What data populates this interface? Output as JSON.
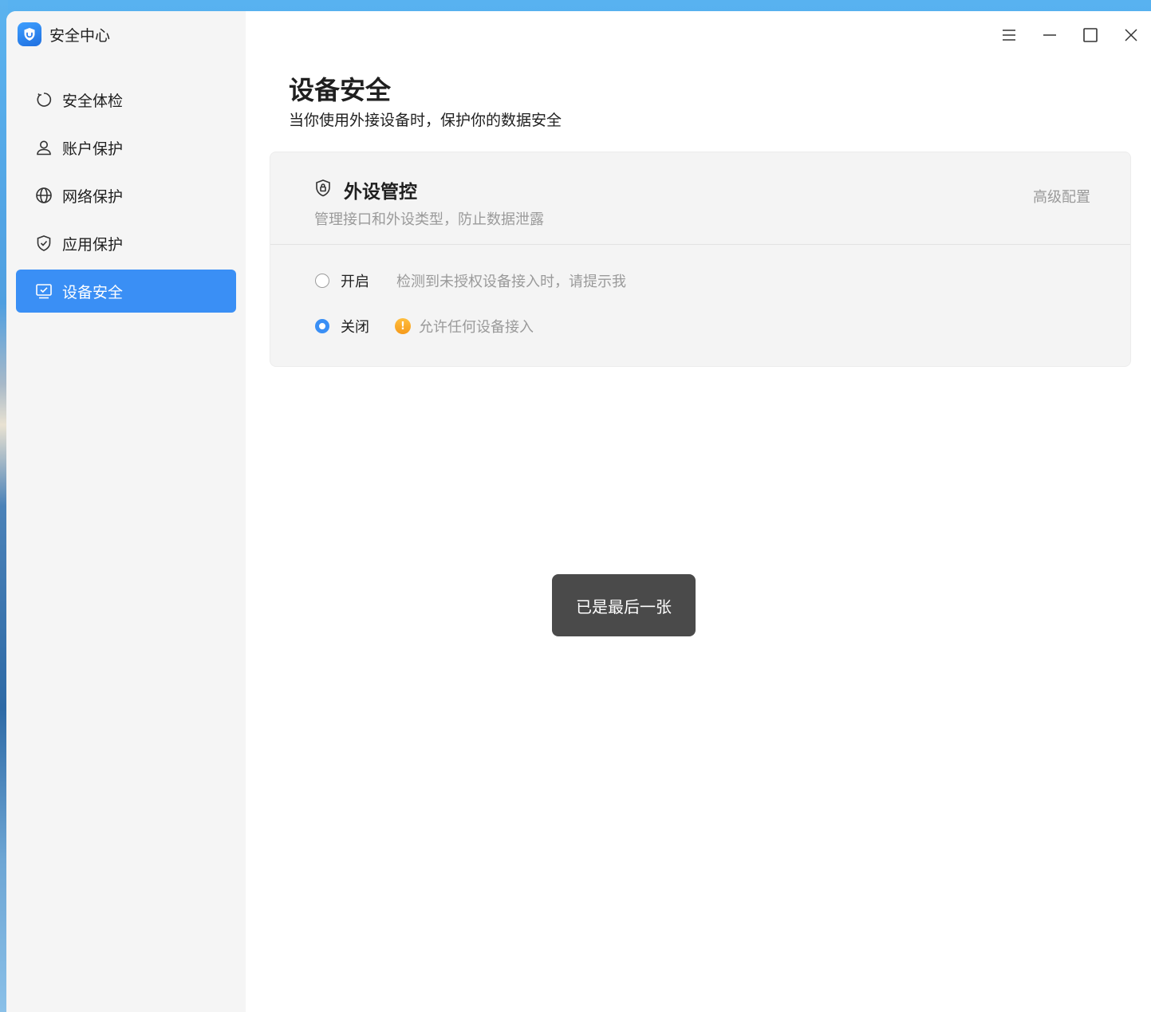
{
  "app": {
    "title": "安全中心"
  },
  "sidebar": {
    "items": [
      {
        "label": "安全体检",
        "icon": "refresh-circle-icon",
        "active": false
      },
      {
        "label": "账户保护",
        "icon": "user-icon",
        "active": false
      },
      {
        "label": "网络保护",
        "icon": "globe-icon",
        "active": false
      },
      {
        "label": "应用保护",
        "icon": "shield-check-icon",
        "active": false
      },
      {
        "label": "设备安全",
        "icon": "monitor-check-icon",
        "active": true
      }
    ]
  },
  "titlebar": {
    "icons": [
      "menu-icon",
      "minimize-icon",
      "maximize-icon",
      "close-icon"
    ]
  },
  "page": {
    "title": "设备安全",
    "subtitle": "当你使用外接设备时，保护你的数据安全"
  },
  "card": {
    "title": "外设管控",
    "description": "管理接口和外设类型，防止数据泄露",
    "advanced_label": "高级配置",
    "options": [
      {
        "label": "开启",
        "description": "检测到未授权设备接入时，请提示我",
        "checked": false
      },
      {
        "label": "关闭",
        "description": "允许任何设备接入",
        "checked": true,
        "warning": true
      }
    ]
  },
  "toast": {
    "text": "已是最后一张"
  },
  "colors": {
    "accent": "#3a8ff5",
    "sidebar_bg": "#f5f5f5",
    "card_bg": "#f4f4f4",
    "muted_text": "#9a9a9a",
    "warning": "#f7a21f",
    "toast_bg": "#4a4a4a"
  }
}
